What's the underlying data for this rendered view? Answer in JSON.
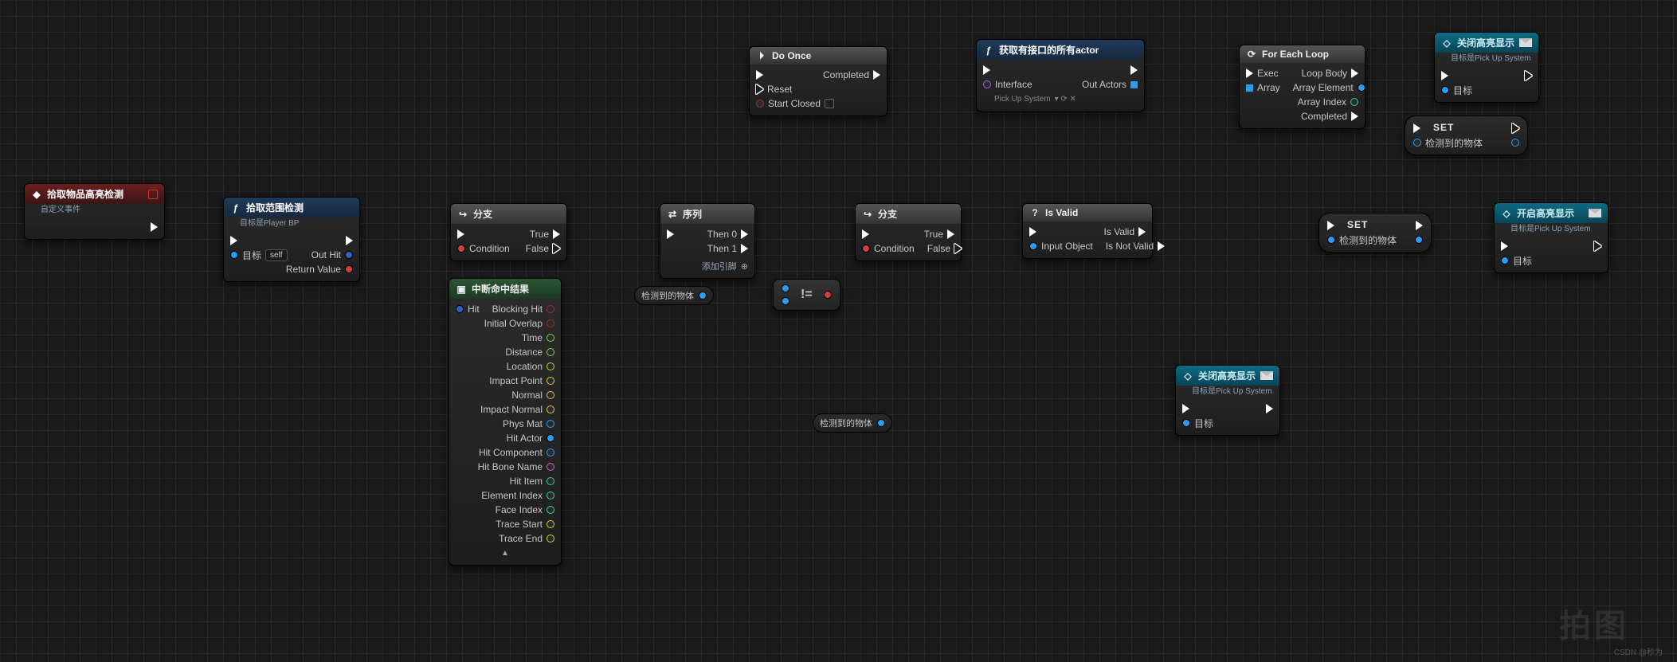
{
  "watermark": {
    "left": "拍图",
    "right": "CSDN @秒为"
  },
  "nodes": {
    "custom_event": {
      "title": "拾取物品高亮检测",
      "sub": "自定义事件"
    },
    "detect_fn": {
      "title": "拾取范围检测",
      "sub": "目标是Player BP",
      "p_target": "目标",
      "p_self": "self",
      "p_outhit": "Out Hit",
      "p_ret": "Return Value"
    },
    "branch1": {
      "title": "分支",
      "p_cond": "Condition",
      "p_true": "True",
      "p_false": "False"
    },
    "sequence": {
      "title": "序列",
      "p_then0": "Then 0",
      "p_then1": "Then 1",
      "p_add": "添加引脚"
    },
    "branch2": {
      "title": "分支",
      "p_cond": "Condition",
      "p_true": "True",
      "p_false": "False"
    },
    "doonce": {
      "title": "Do Once",
      "p_reset": "Reset",
      "p_start": "Start Closed",
      "p_done": "Completed"
    },
    "break_hit": {
      "title": "中断命中结果",
      "p_hit": "Hit",
      "outs": [
        "Blocking Hit",
        "Initial Overlap",
        "Time",
        "Distance",
        "Location",
        "Impact Point",
        "Normal",
        "Impact Normal",
        "Phys Mat",
        "Hit Actor",
        "Hit Component",
        "Hit Bone Name",
        "Hit Item",
        "Element Index",
        "Face Index",
        "Trace Start",
        "Trace End"
      ]
    },
    "get_detected1": {
      "label": "检测到的物体"
    },
    "get_detected2": {
      "label": "检测到的物体"
    },
    "neq": {
      "label": "!="
    },
    "allactors": {
      "title": "获取有接口的所有actor",
      "p_iface": "Interface",
      "p_iface_val": "Pick Up System",
      "p_out": "Out Actors"
    },
    "isvalid": {
      "title": "Is Valid",
      "p_in": "Input Object",
      "p_valid": "Is Valid",
      "p_notvalid": "Is Not Valid"
    },
    "foreach": {
      "title": "For Each Loop",
      "p_exec": "Exec",
      "p_array": "Array",
      "p_body": "Loop Body",
      "p_elem": "Array Element",
      "p_idx": "Array Index",
      "p_done": "Completed"
    },
    "close_hl1": {
      "title": "关闭高亮显示",
      "sub": "目标是Pick Up System",
      "p_target": "目标"
    },
    "close_hl2": {
      "title": "关闭高亮显示",
      "sub": "目标是Pick Up System",
      "p_target": "目标"
    },
    "open_hl": {
      "title": "开启高亮显示",
      "sub": "目标是Pick Up System",
      "p_target": "目标"
    },
    "set1": {
      "title": "SET",
      "p_var": "检测到的物体"
    },
    "set2": {
      "title": "SET",
      "p_var": "检测到的物体"
    }
  }
}
